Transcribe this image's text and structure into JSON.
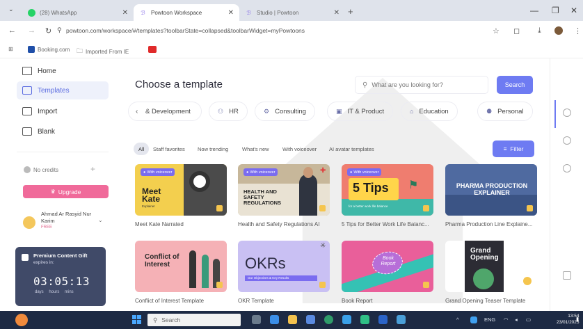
{
  "browser": {
    "tabs": [
      {
        "label": "(28) WhatsApp",
        "icon": "whatsapp-icon",
        "active": false
      },
      {
        "label": "Powtoon Workspace",
        "icon": "powtoon-icon",
        "active": true
      },
      {
        "label": "Studio | Powtoon",
        "icon": "powtoon-icon",
        "active": false
      }
    ],
    "url": "powtoon.com/workspace/#/templates?toolbarState=collapsed&toolbarWidget=myPowtoons",
    "bookmarks": [
      "Booking.com",
      "Imported From IE"
    ]
  },
  "sidebar": {
    "items": [
      {
        "label": "Home",
        "icon": "home-icon"
      },
      {
        "label": "Templates",
        "icon": "templates-icon",
        "selected": true
      },
      {
        "label": "Import",
        "icon": "import-icon"
      },
      {
        "label": "Blank",
        "icon": "blank-icon"
      }
    ],
    "credits": "No credits",
    "upgrade_label": "Upgrade",
    "profile": {
      "name": "Ahmad Ar Rasyid Nur Karim",
      "badge": "FREE"
    },
    "gift": {
      "title": "Premium Content Gift",
      "subtitle": "expires in:",
      "timer": "03:05:13",
      "timer_labels": "days hours mins"
    }
  },
  "main": {
    "heading": "Choose a template",
    "search": {
      "placeholder": "What are you looking for?",
      "button": "Search"
    },
    "categories": [
      {
        "label": "& Development",
        "icon": ""
      },
      {
        "label": "HR",
        "icon": "hr-icon"
      },
      {
        "label": "Consulting",
        "icon": "consulting-icon"
      },
      {
        "label": "IT & Product",
        "icon": "it-icon"
      },
      {
        "label": "Education",
        "icon": "education-icon"
      },
      {
        "label": "Personal",
        "icon": "personal-icon"
      }
    ],
    "chips": [
      "All",
      "Staff favorites",
      "Now trending",
      "What's new",
      "With voiceover",
      "AI avatar templates"
    ],
    "filter_label": "Filter",
    "cards": [
      {
        "title": "Meet Kate Narrated",
        "badge": "With voiceover",
        "thumb_text": "Meet Kate",
        "thumb_sub": "Explainer"
      },
      {
        "title": "Health and Safety Regulations AI",
        "badge": "With voiceover",
        "thumb_text": "HEALTH AND SAFETY REGULATIONS"
      },
      {
        "title": "5 Tips for Better Work Life Balanc...",
        "badge": "With voiceover",
        "thumb_text": "5 Tips",
        "thumb_sub": "for a better work life balance"
      },
      {
        "title": "Pharma Production Line Explaine...",
        "thumb_text": "PHARMA PRODUCTION EXPLAINER"
      },
      {
        "title": "Conflict of Interest Template",
        "thumb_text": "Conflict of Interest"
      },
      {
        "title": "OKR Template",
        "thumb_text": "OKRs",
        "thumb_sub": "Our Objectives & Key Results"
      },
      {
        "title": "Book Report",
        "thumb_text": "Book Report"
      },
      {
        "title": "Grand Opening Teaser Template",
        "thumb_text": "Grand Opening"
      }
    ]
  },
  "taskbar": {
    "search_placeholder": "Search",
    "lang": "ENG",
    "time": "13:54",
    "date": "23/01/2025"
  },
  "colors": {
    "accent": "#6e7bf2",
    "upgrade": "#f06a9a",
    "gift_bg": "#404a68",
    "taskbar": "#1d2a44"
  }
}
